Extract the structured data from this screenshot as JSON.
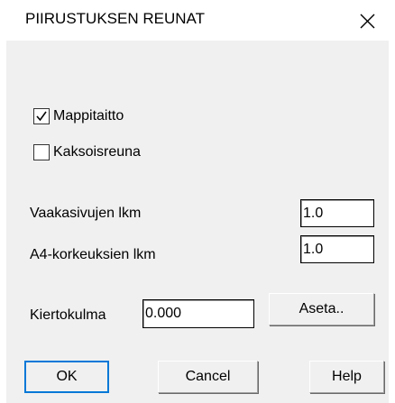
{
  "dialog": {
    "title": "PIIRUSTUKSEN REUNAT",
    "close_icon": "close-icon"
  },
  "checkboxes": {
    "mappitaitto": {
      "label": "Mappitaitto",
      "checked": true
    },
    "kaksoisreuna": {
      "label": "Kaksoisreuna",
      "checked": false
    }
  },
  "fields": {
    "vaakasivujen": {
      "label": "Vaakasivujen lkm",
      "value": "1.0"
    },
    "a4korkeuksien": {
      "label": "A4-korkeuksien lkm",
      "value": "1.0"
    },
    "kiertokulma": {
      "label": "Kiertokulma",
      "value": "0.000"
    }
  },
  "buttons": {
    "aseta": "Aseta..",
    "ok": "OK",
    "cancel": "Cancel",
    "help": "Help"
  },
  "colors": {
    "background": "#f0f0f0",
    "title_bar": "#ffffff",
    "default_button_border": "#0078d7"
  }
}
